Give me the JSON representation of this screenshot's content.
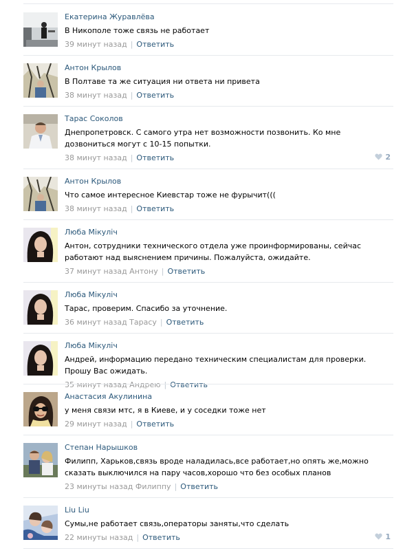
{
  "comments": [
    {
      "author": "Екатерина Журавлёва",
      "text": "В Никополе тоже связь не работает",
      "time": "39 минут назад",
      "reply": "Ответить",
      "avatar": "bw-figure"
    },
    {
      "author": "Антон Крылов",
      "text": "В Полтаве та же ситуация ни ответа ни привета",
      "time": "38 минут назад",
      "reply": "Ответить",
      "avatar": "tree-man"
    },
    {
      "author": "Тарас Соколов",
      "text": "Днепропетровск. С самого утра нет возможности позвонить. Ко мне дозвониться могут с 10-15 попытки.",
      "time": "38 минут назад",
      "reply": "Ответить",
      "likes": "2",
      "avatar": "man-shirt"
    },
    {
      "author": "Антон Крылов",
      "text": "Что самое интересное Киевстар тоже не фурычит(((",
      "time": "38 минут назад",
      "reply": "Ответить",
      "avatar": "tree-man"
    },
    {
      "author": "Люба Мікуліч",
      "text": "Антон, сотрудники технического отдела уже проинформированы, сейчас работают над выяснением причины. Пожалуйста, ожидайте.",
      "time": "37 минут назад Антону",
      "reply": "Ответить",
      "avatar": "woman-dark"
    },
    {
      "author": "Люба Мікуліч",
      "text": "Тарас, проверим. Спасибо за уточнение.",
      "time": "36 минут назад Тарасу",
      "reply": "Ответить",
      "avatar": "woman-dark"
    },
    {
      "author": "Люба Мікуліч",
      "text": "Андрей, информацию передано техническим специалистам для проверки. Прошу Вас ожидать.",
      "time": "35 минут назад Андрею",
      "reply": "Ответить",
      "avatar": "woman-dark"
    },
    {
      "author": "Анастасия Акулинина",
      "text": "у меня связи мтс, я в Киеве, и у соседки тоже нет",
      "time": "29 минут назад",
      "reply": "Ответить",
      "avatar": "woman-sunglasses"
    },
    {
      "author": "Степан Нарышков",
      "text": "Филипп, Харьков,связь вроде наладилась,все работает,но опять же,можно сказать выключился на пару часов,хорошо что без особых планов",
      "time": "23 минуты назад Филиппу",
      "reply": "Ответить",
      "avatar": "couple"
    },
    {
      "author": "Liu Liu",
      "text": "Сумы,не работает связь,операторы заняты,что сделать",
      "time": "22 минуты назад",
      "reply": "Ответить",
      "likes": "1",
      "avatar": "two-girls"
    }
  ],
  "colors": {
    "link": "#2b587a",
    "meta": "#999999",
    "divider": "#e6e9ed",
    "like": "#93a7bd"
  }
}
